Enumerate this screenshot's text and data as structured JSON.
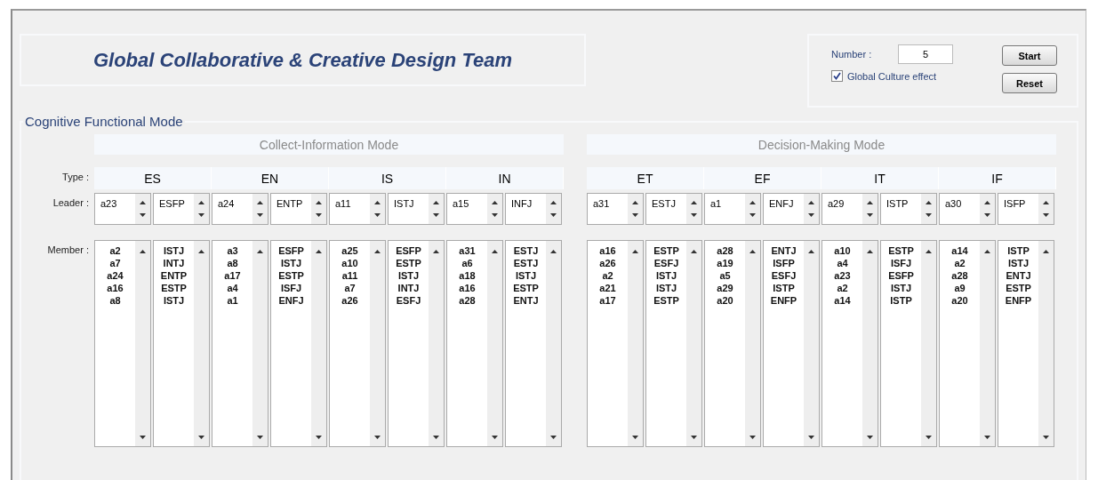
{
  "title": "Global Collaborative & Creative Design Team",
  "controls": {
    "number_label": "Number :",
    "number_value": "5",
    "culture_effect": {
      "label": "Global Culture effect",
      "checked": true
    },
    "buttons": [
      "Start",
      "Reset"
    ]
  },
  "panel": {
    "title": "Cognitive Functional Mode",
    "row_labels": [
      "Type :",
      "Leader :",
      "Member :"
    ],
    "modes": [
      {
        "title": "Collect-Information Mode",
        "types": [
          {
            "type": "ES",
            "leader": "a23",
            "leader_type": "ESFP",
            "members": [
              "a2",
              "a7",
              "a24",
              "a16",
              "a8"
            ],
            "member_types": [
              "ISTJ",
              "INTJ",
              "ENTP",
              "ESTP",
              "ISTJ"
            ]
          },
          {
            "type": "EN",
            "leader": "a24",
            "leader_type": "ENTP",
            "members": [
              "a3",
              "a8",
              "a17",
              "a4",
              "a1"
            ],
            "member_types": [
              "ESFP",
              "ISTJ",
              "ESTP",
              "ISFJ",
              "ENFJ"
            ]
          },
          {
            "type": "IS",
            "leader": "a11",
            "leader_type": "ISTJ",
            "members": [
              "a25",
              "a10",
              "a11",
              "a7",
              "a26"
            ],
            "member_types": [
              "ESFP",
              "ESTP",
              "ISTJ",
              "INTJ",
              "ESFJ"
            ]
          },
          {
            "type": "IN",
            "leader": "a15",
            "leader_type": "INFJ",
            "members": [
              "a31",
              "a6",
              "a18",
              "a16",
              "a28"
            ],
            "member_types": [
              "ESTJ",
              "ESTJ",
              "ISTJ",
              "ESTP",
              "ENTJ"
            ]
          }
        ]
      },
      {
        "title": "Decision-Making Mode",
        "types": [
          {
            "type": "ET",
            "leader": "a31",
            "leader_type": "ESTJ",
            "members": [
              "a16",
              "a26",
              "a2",
              "a21",
              "a17"
            ],
            "member_types": [
              "ESTP",
              "ESFJ",
              "ISTJ",
              "ISTJ",
              "ESTP"
            ]
          },
          {
            "type": "EF",
            "leader": "a1",
            "leader_type": "ENFJ",
            "members": [
              "a28",
              "a19",
              "a5",
              "a29",
              "a20"
            ],
            "member_types": [
              "ENTJ",
              "ISFP",
              "ESFJ",
              "ISTP",
              "ENFP"
            ]
          },
          {
            "type": "IT",
            "leader": "a29",
            "leader_type": "ISTP",
            "members": [
              "a10",
              "a4",
              "a23",
              "a2",
              "a14"
            ],
            "member_types": [
              "ESTP",
              "ISFJ",
              "ESFP",
              "ISTJ",
              "ISTP"
            ]
          },
          {
            "type": "IF",
            "leader": "a30",
            "leader_type": "ISFP",
            "members": [
              "a14",
              "a2",
              "a28",
              "a9",
              "a20"
            ],
            "member_types": [
              "ISTP",
              "ISTJ",
              "ENTJ",
              "ESTP",
              "ENFP"
            ]
          }
        ]
      }
    ]
  }
}
